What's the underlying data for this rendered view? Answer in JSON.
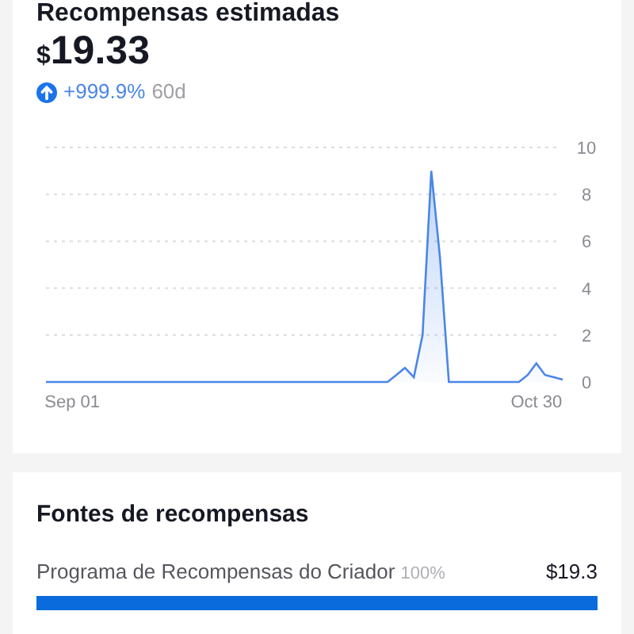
{
  "rewards": {
    "title": "Recompensas estimadas",
    "currency": "$",
    "amount": "19.33",
    "trend": {
      "change": "+999.9%",
      "period": "60d"
    },
    "chart_data": {
      "type": "area",
      "categories": [
        null,
        null,
        null,
        "Sep 01",
        null,
        null,
        null,
        null,
        null,
        null,
        null,
        null,
        null,
        null,
        null,
        null,
        null,
        null,
        null,
        null,
        null,
        null,
        null,
        null,
        null,
        null,
        null,
        null,
        null,
        null,
        null,
        null,
        null,
        null,
        null,
        null,
        null,
        null,
        null,
        null,
        null,
        null,
        null,
        null,
        null,
        null,
        null,
        null,
        null,
        null,
        null,
        null,
        null,
        null,
        null,
        null,
        "Oct 30",
        null,
        null,
        null
      ],
      "series": [
        {
          "color": "#4a86e8",
          "values": [
            0,
            0,
            0,
            0,
            0,
            0,
            0,
            0,
            0,
            0,
            0,
            0,
            0,
            0,
            0,
            0,
            0,
            0,
            0,
            0,
            0,
            0,
            0,
            0,
            0,
            0,
            0,
            0,
            0,
            0,
            0,
            0,
            0,
            0,
            0,
            0,
            0,
            0,
            0,
            0,
            0.3,
            0.6,
            0.2,
            2,
            9,
            5.3,
            0,
            0,
            0,
            0,
            0,
            0,
            0,
            0,
            0,
            0.3,
            0.8,
            0.3,
            0.2,
            0.1
          ]
        }
      ],
      "yticks": [
        0,
        2,
        4,
        6,
        8,
        10
      ],
      "ylim": [
        0,
        10
      ],
      "grid": true
    }
  },
  "sources": {
    "title": "Fontes de recompensas",
    "items": [
      {
        "name": "Programa de Recompensas do Criador",
        "share": "100%",
        "value": "$19.3",
        "level": 1.0,
        "color": "#0a6bdc"
      }
    ]
  }
}
